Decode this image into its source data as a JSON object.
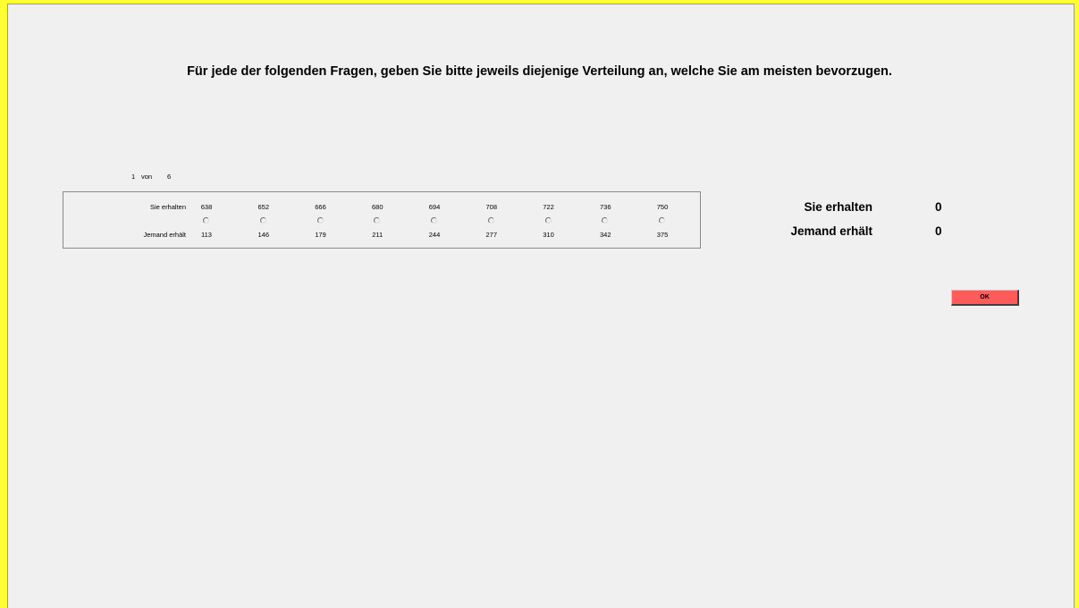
{
  "instruction": "Für jede der folgenden Fragen, geben Sie bitte jeweils diejenige Verteilung an, welche Sie am meisten bevorzugen.",
  "progress": {
    "current": "1",
    "separator": "von",
    "total": "6"
  },
  "choice": {
    "you_label": "Sie erhalten",
    "other_label": "Jemand erhält",
    "you_values": [
      "638",
      "652",
      "666",
      "680",
      "694",
      "708",
      "722",
      "736",
      "750"
    ],
    "other_values": [
      "113",
      "146",
      "179",
      "211",
      "244",
      "277",
      "310",
      "342",
      "375"
    ],
    "selected_index": null
  },
  "summary": {
    "you_label": "Sie erhalten",
    "you_value": "0",
    "other_label": "Jemand erhält",
    "other_value": "0"
  },
  "ok_button": {
    "label": "OK",
    "color": "#ff5b5b"
  },
  "colors": {
    "frame": "#ffff33",
    "background": "#f0f0f0"
  }
}
